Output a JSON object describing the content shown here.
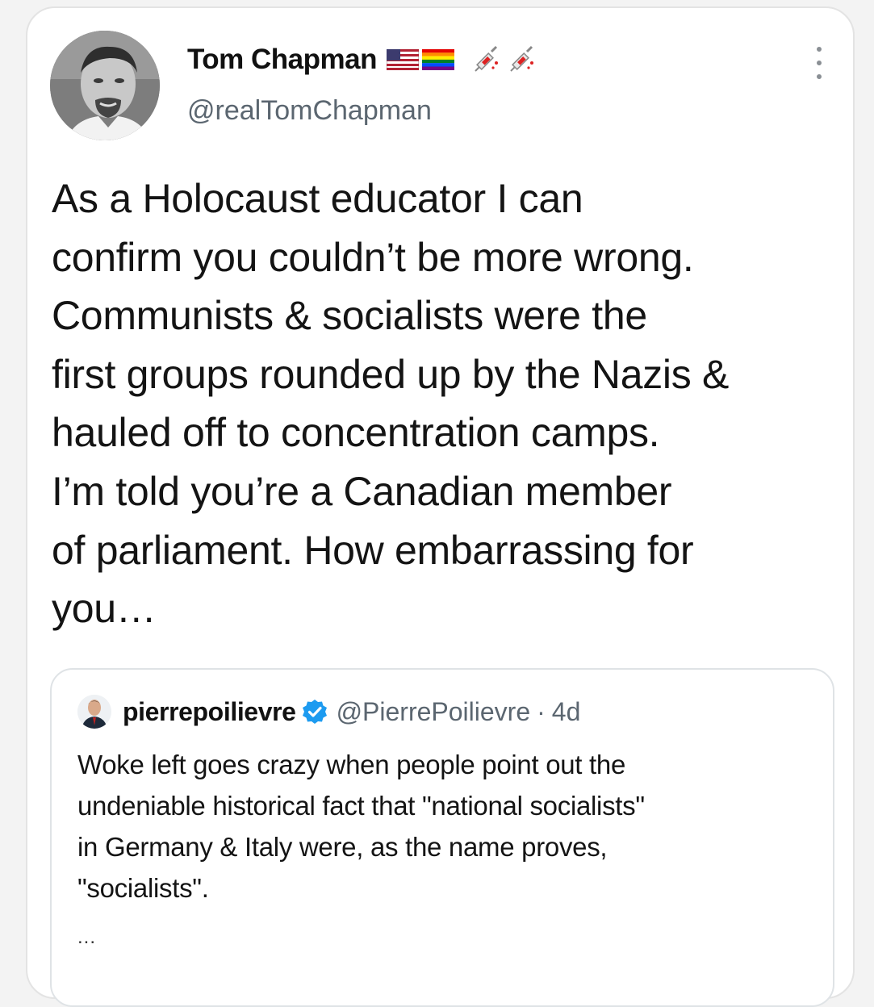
{
  "tweet": {
    "author_name": "Tom Chapman",
    "author_handle": "@realTomChapman",
    "name_icons": [
      "us-flag-icon",
      "rainbow-flag-icon",
      "syringe-icon",
      "syringe-icon"
    ],
    "text_lines": [
      "As a Holocaust educator I can",
      "confirm you couldn’t be more wrong.",
      "Communists & socialists were the",
      "first groups rounded up by the Nazis &",
      "hauled off to concentration camps.",
      "I’m told you’re a Canadian member",
      "of parliament. How embarrassing for",
      "you…"
    ],
    "more_icon": "more-vertical-icon"
  },
  "quoted_tweet": {
    "author_name": "pierrepoilievre",
    "verified": true,
    "author_handle": "@PierrePoilievre",
    "separator": "·",
    "time": "4d",
    "text_lines": [
      "Woke left goes crazy when people point out the",
      "undeniable historical fact that \"national socialists\"",
      "in Germany & Italy were, as the name proves,",
      "\"socialists\"."
    ],
    "truncation": "..."
  },
  "colors": {
    "background": "#f3f3f3",
    "card": "#ffffff",
    "text": "#141414",
    "secondary_text": "#5b6670",
    "verified_blue": "#1d9bf0",
    "border": "#e3e3e3"
  }
}
